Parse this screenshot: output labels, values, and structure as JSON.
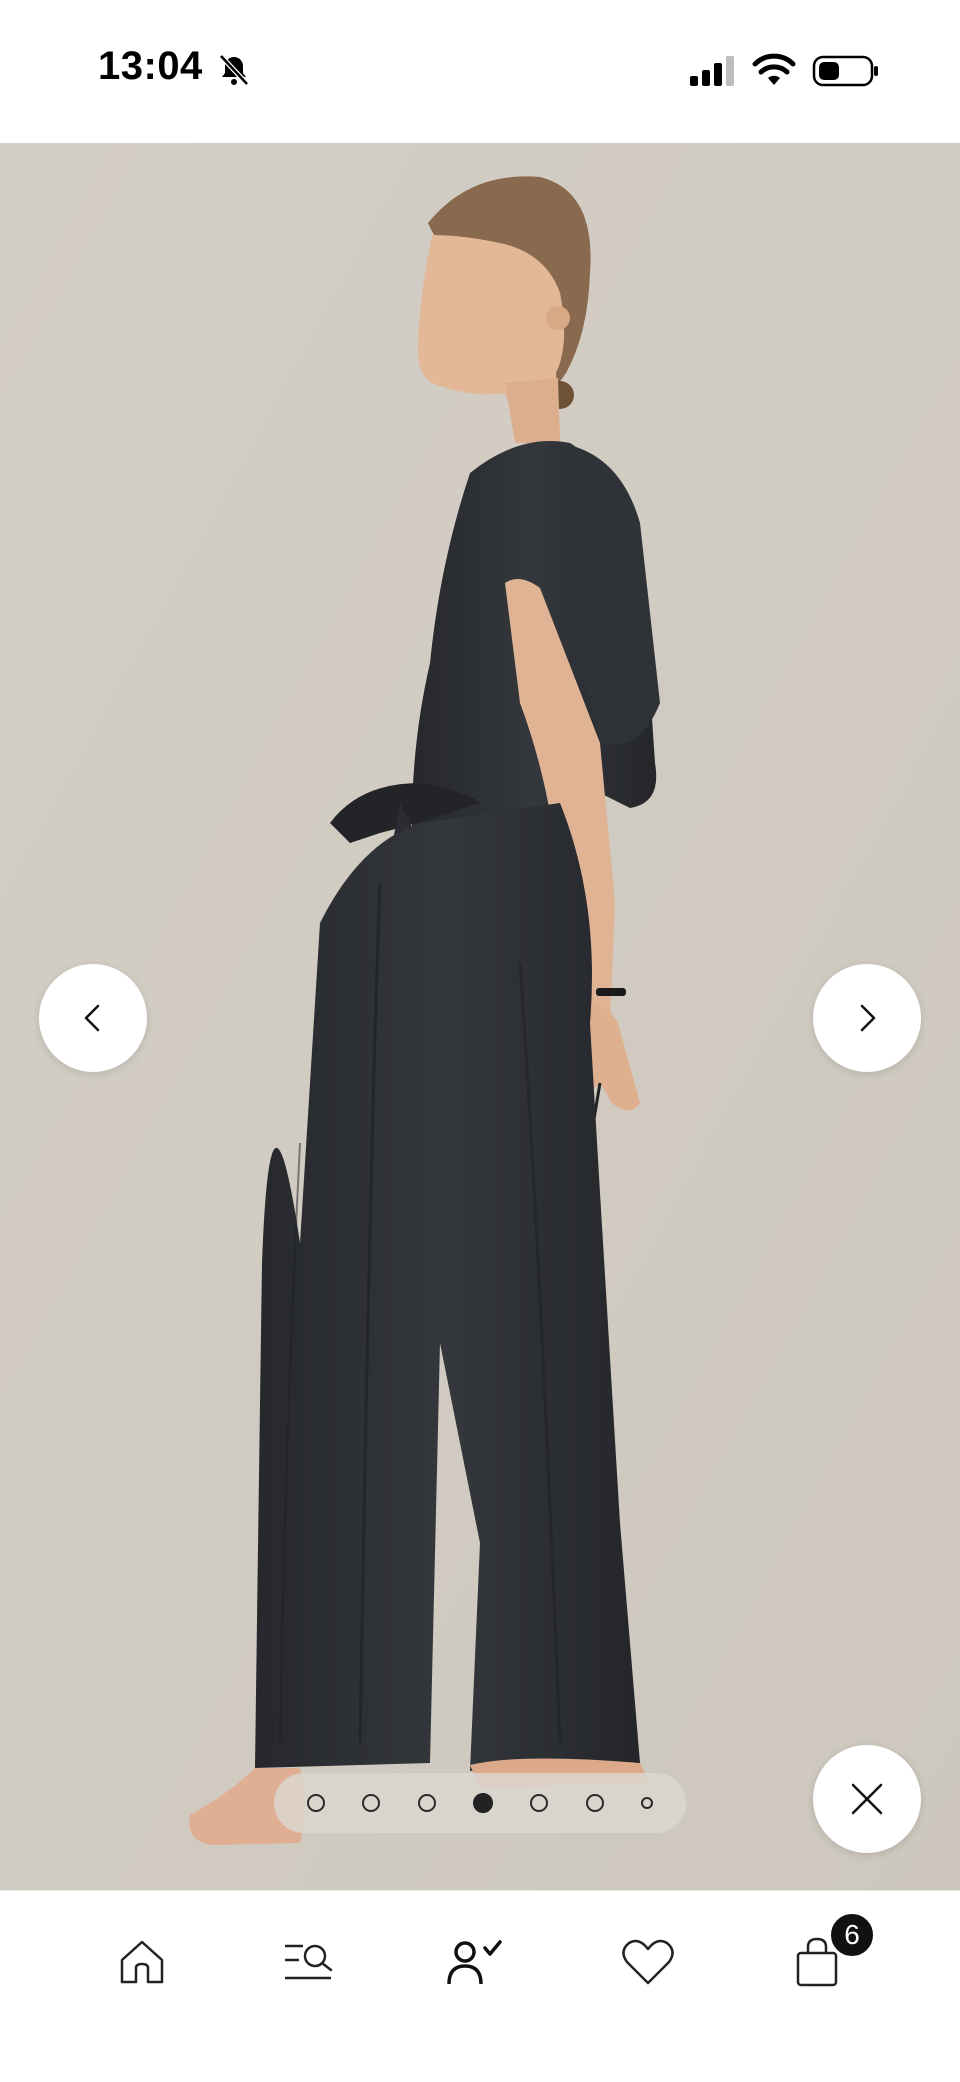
{
  "status_bar": {
    "time": "13:04",
    "icons": [
      "bell-slash-icon",
      "cellular-signal-icon",
      "wifi-icon",
      "battery-icon"
    ]
  },
  "gallery": {
    "slide_count": 7,
    "active_slide": 4,
    "prev_icon": "chevron-left-icon",
    "next_icon": "chevron-right-icon",
    "close_icon": "close-icon"
  },
  "tab_bar": {
    "items": [
      {
        "icon": "home-icon"
      },
      {
        "icon": "search-menu-icon"
      },
      {
        "icon": "account-check-icon"
      },
      {
        "icon": "heart-icon"
      },
      {
        "icon": "shopping-bag-icon"
      }
    ],
    "cart_count": "6"
  },
  "colors": {
    "backdrop": "#d2cdc4",
    "garment": "#2d2f33",
    "accent": "#111111"
  }
}
